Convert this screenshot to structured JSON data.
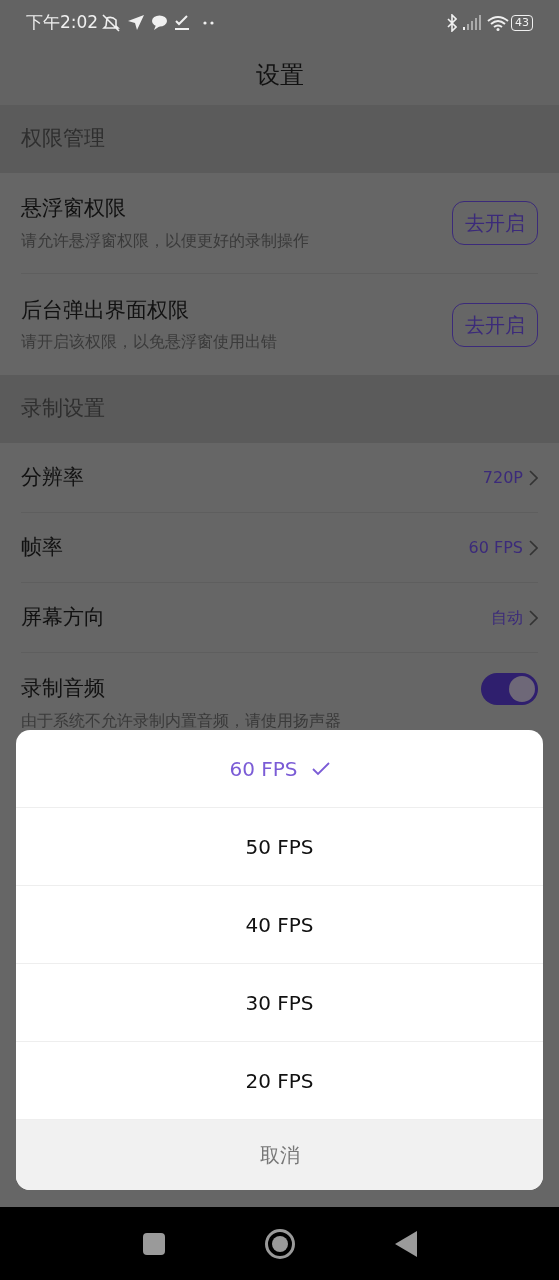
{
  "status_bar": {
    "time": "下午2:02",
    "battery": "43"
  },
  "title": "设置",
  "sections": [
    {
      "header": "权限管理",
      "items": [
        {
          "kind": "button",
          "title": "悬浮窗权限",
          "subtitle": "请允许悬浮窗权限，以便更好的录制操作",
          "action": "去开启"
        },
        {
          "kind": "button",
          "title": "后台弹出界面权限",
          "subtitle": "请开启该权限，以免悬浮窗使用出错",
          "action": "去开启"
        }
      ]
    },
    {
      "header": "录制设置",
      "items": [
        {
          "kind": "value",
          "title": "分辨率",
          "value": "720P"
        },
        {
          "kind": "value",
          "title": "帧率",
          "value": "60 FPS"
        },
        {
          "kind": "value",
          "title": "屏幕方向",
          "value": "自动"
        },
        {
          "kind": "toggle",
          "title": "录制音频",
          "subtitle": "由于系统不允许录制内置音频，请使用扬声器",
          "on": true
        }
      ]
    }
  ],
  "sheet": {
    "options": [
      {
        "label": "60 FPS",
        "selected": true
      },
      {
        "label": "50 FPS",
        "selected": false
      },
      {
        "label": "40 FPS",
        "selected": false
      },
      {
        "label": "30 FPS",
        "selected": false
      },
      {
        "label": "20 FPS",
        "selected": false
      }
    ],
    "cancel": "取消"
  }
}
